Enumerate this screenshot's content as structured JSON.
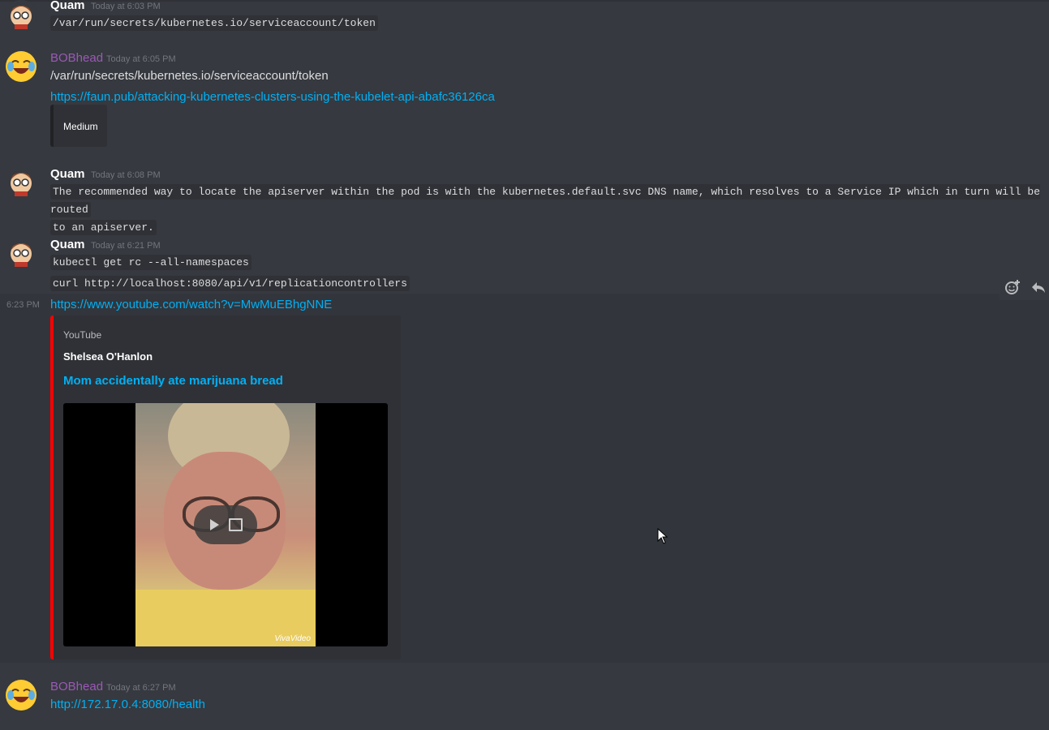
{
  "messages": [
    {
      "author": "Quam",
      "timestamp": "Today at 6:03 PM",
      "lines": [
        "/var/run/secrets/kubernetes.io/serviceaccount/token"
      ]
    },
    {
      "author": "BOBhead",
      "timestamp": "Today at 6:05 PM",
      "text": "/var/run/secrets/kubernetes.io/serviceaccount/token",
      "link": "https://faun.pub/attacking-kubernetes-clusters-using-the-kubelet-api-abafc36126ca",
      "embed_title": "Medium"
    },
    {
      "author": "Quam",
      "timestamp": "Today at 6:08 PM",
      "code_line1": "The recommended way to locate the apiserver within the pod is with the kubernetes.default.svc DNS name, which resolves to a Service IP which in turn will be routed",
      "code_line2": "to an apiserver."
    },
    {
      "author": "Quam",
      "timestamp": "Today at 6:21 PM",
      "lines": [
        "kubectl get rc --all-namespaces",
        "curl http://localhost:8080/api/v1/replicationcontrollers"
      ]
    },
    {
      "timestamp": "6:23 PM",
      "link": "https://www.youtube.com/watch?v=MwMuEBhgNNE",
      "embed": {
        "provider": "YouTube",
        "author": "Shelsea O'Hanlon",
        "title": "Mom accidentally ate marijuana bread",
        "watermark": "VivaVideo"
      }
    },
    {
      "author": "BOBhead",
      "timestamp": "Today at 6:27 PM",
      "link": "http://172.17.0.4:8080/health"
    }
  ],
  "colors": {
    "background": "#36393f",
    "link": "#00b0f4",
    "bob": "#9b59b6",
    "youtube_border": "#ff0000"
  },
  "icons": {
    "add_reaction": "add-reaction-icon",
    "reply": "reply-icon"
  }
}
